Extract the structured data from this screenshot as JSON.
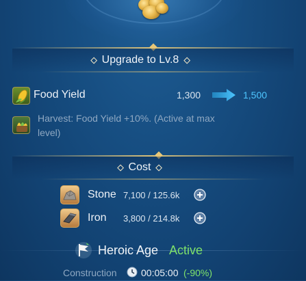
{
  "upgrade": {
    "header": "Upgrade to Lv.8",
    "stats": [
      {
        "icon": "corn-icon",
        "label": "Food Yield",
        "current": "1,300",
        "next": "1,500"
      }
    ],
    "bonus": {
      "icon": "harvest-icon",
      "text_line1": "Harvest: Food Yield +10%.  (Active at max",
      "text_line2": "level)"
    }
  },
  "cost": {
    "header": "Cost",
    "items": [
      {
        "icon": "stone-icon",
        "name": "Stone",
        "amount": "7,100 / 125.6k"
      },
      {
        "icon": "iron-icon",
        "name": "Iron",
        "amount": "3,800 / 214.8k"
      }
    ]
  },
  "heroic": {
    "icon": "heroic-flag-icon",
    "title": "Heroic Age",
    "status": "Active"
  },
  "construction": {
    "label": "Construction",
    "time": "00:05:00",
    "discount": "(-90%)"
  },
  "colors": {
    "accent_cyan": "#4ec6ff",
    "active_green": "#7fe36a",
    "gold": "#e8c777",
    "muted_text": "#8fa8c2"
  }
}
